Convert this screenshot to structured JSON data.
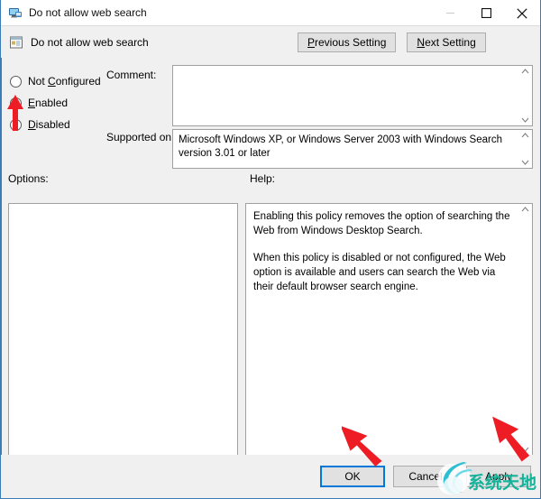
{
  "window": {
    "title": "Do not allow web search",
    "title_icon": "policy-monitor-icon",
    "controls": {
      "minimize": "minimize-icon",
      "maximize": "maximize-icon",
      "close": "close-icon"
    }
  },
  "header": {
    "policy_name": "Do not allow web search",
    "policy_icon": "policy-setting-icon",
    "previous_setting": "Previous Setting",
    "previous_setting_accel": "P",
    "next_setting": "Next Setting",
    "next_setting_accel": "N"
  },
  "state_options": [
    {
      "label": "Not Configured",
      "accel": "C",
      "selected": false
    },
    {
      "label": "Enabled",
      "accel": "E",
      "selected": true
    },
    {
      "label": "Disabled",
      "accel": "D",
      "selected": false
    }
  ],
  "fields": {
    "comment_label": "Comment:",
    "comment_value": "",
    "supported_label": "Supported on:",
    "supported_value": "Microsoft Windows XP, or Windows Server 2003 with Windows Search version 3.01 or later",
    "options_label": "Options:",
    "options_value": "",
    "help_label": "Help:"
  },
  "help": {
    "paragraph_1": "Enabling this policy removes the option of searching the Web from Windows Desktop Search.",
    "paragraph_2": "When this policy is disabled or not configured, the Web option is available and users can search the Web via their default browser search engine."
  },
  "footer": {
    "ok": "OK",
    "cancel": "Cancel",
    "apply": "Apply"
  },
  "annotations": {
    "arrow_color": "#ee1c25",
    "arrow_radio_target": "Enabled",
    "arrow_ok_target": "OK",
    "arrow_apply_target": "Apply"
  },
  "watermark": {
    "text": "系统天地",
    "color": "#15b39a"
  },
  "colors": {
    "accent": "#0078d7",
    "window_border": "#3a7cb8",
    "dialog_bg": "#f0f0f0",
    "button_bg": "#e1e1e1"
  }
}
